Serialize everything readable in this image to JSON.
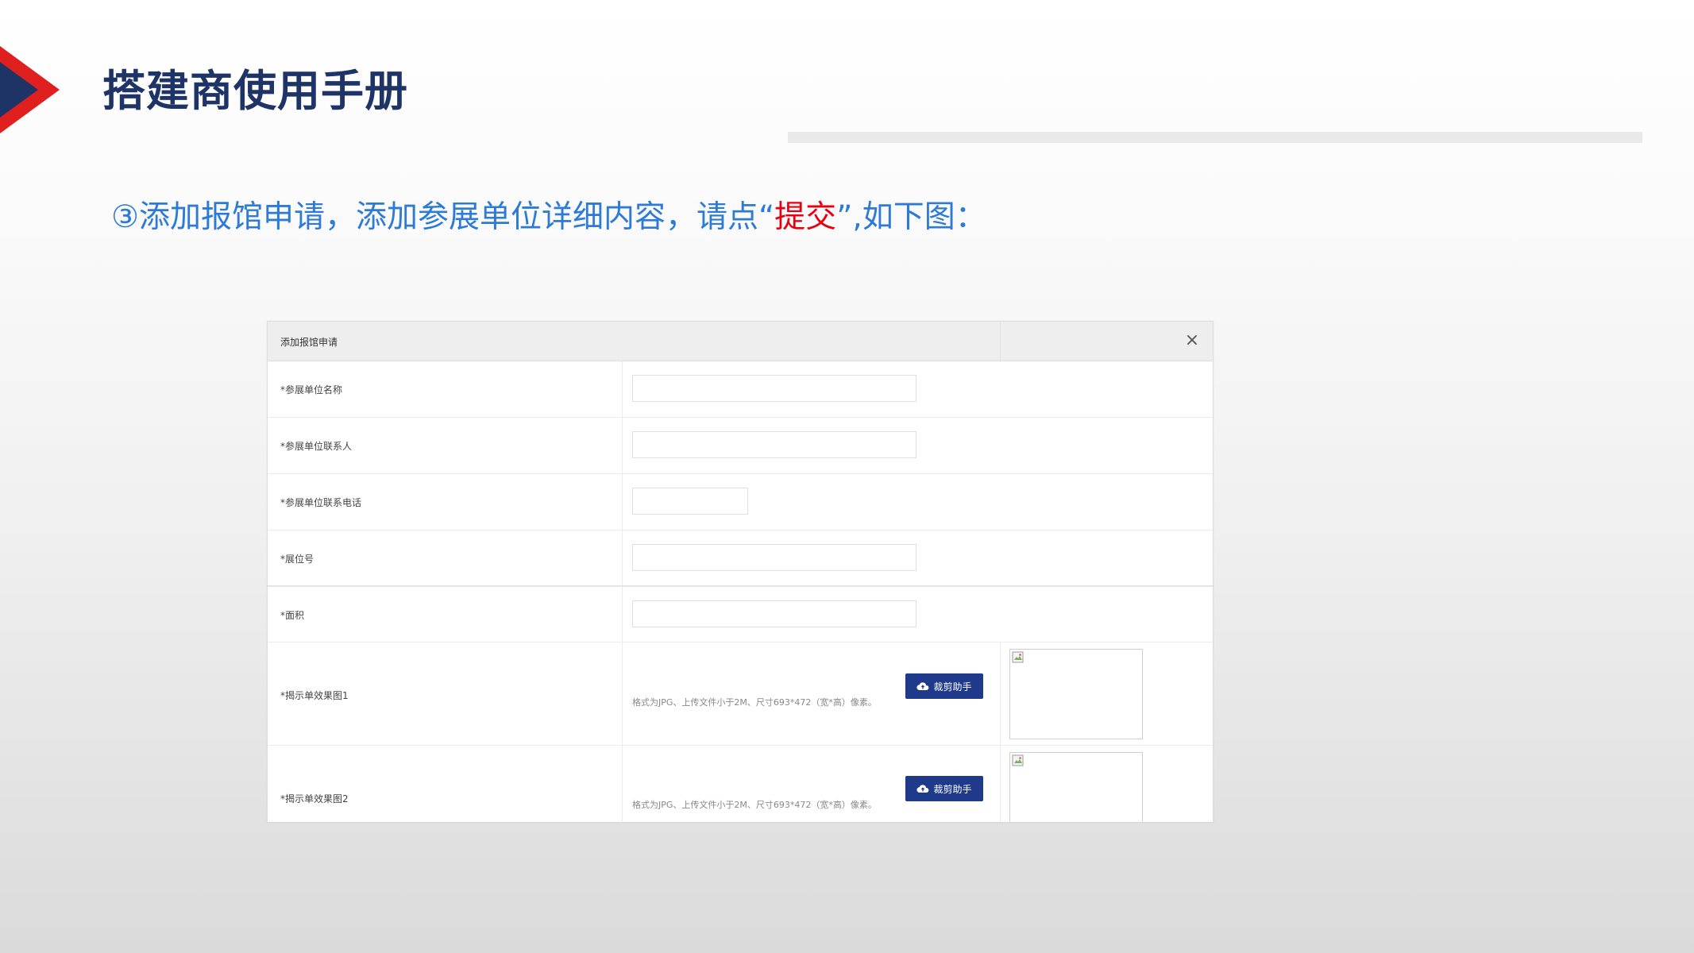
{
  "slide": {
    "title": "搭建商使用手册",
    "instruction_prefix": "③添加报馆申请，添加参展单位详细内容，请点“",
    "instruction_highlight": "提交",
    "instruction_suffix": "”,如下图：",
    "colors": {
      "title": "#1f3466",
      "instruction": "#2e7bd6",
      "highlight": "#e60012",
      "logo_red": "#e0201f",
      "logo_navy": "#1f3466"
    }
  },
  "dialog": {
    "title": "添加报馆申请",
    "close_icon": "close-icon",
    "fields": [
      {
        "label": "*参展单位名称",
        "value": ""
      },
      {
        "label": "*参展单位联系人",
        "value": ""
      },
      {
        "label": "*参展单位联系电话",
        "value": ""
      },
      {
        "label": "*展位号",
        "value": ""
      },
      {
        "label": "*面积",
        "value": ""
      }
    ],
    "uploads": [
      {
        "label": "*揭示单效果图1",
        "hint": "格式为JPG、上传文件小于2M、尺寸693*472（宽*高）像素。",
        "button": "裁剪助手"
      },
      {
        "label": "*揭示单效果图2",
        "hint": "格式为JPG、上传文件小于2M、尺寸693*472（宽*高）像素。",
        "button": "裁剪助手"
      }
    ],
    "button_color": "#1f3a8a",
    "upload_icon": "cloud-upload-icon"
  }
}
